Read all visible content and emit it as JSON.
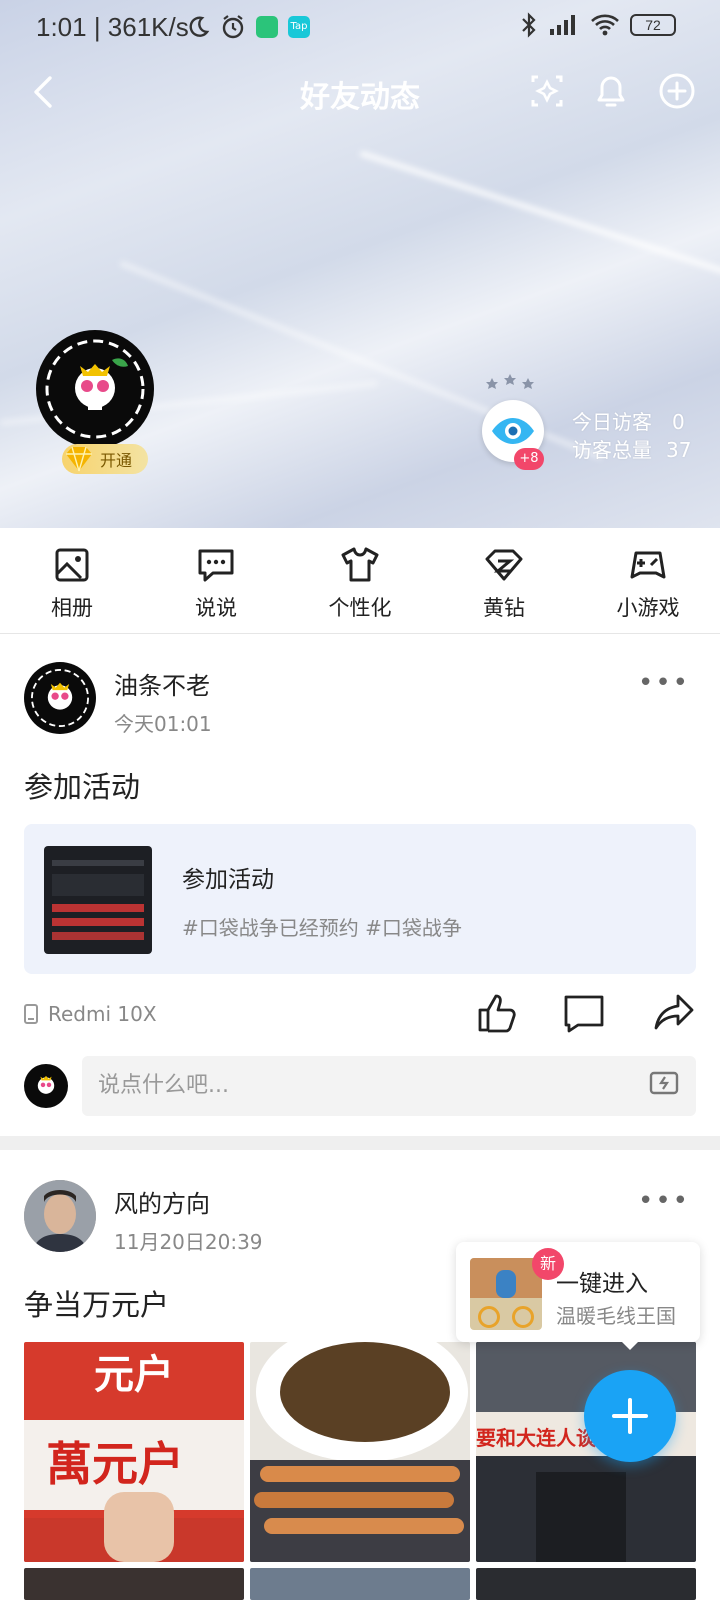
{
  "status_bar": {
    "time": "1:01 | 361K/s",
    "battery": "72",
    "app_badge": "Tap"
  },
  "nav": {
    "title": "好友动态"
  },
  "profile": {
    "vip_label": "开通",
    "visitor_plus": "+8",
    "today_visitors_label": "今日访客",
    "today_visitors_value": "0",
    "total_visitors_label": "访客总量",
    "total_visitors_value": "37"
  },
  "tabs": [
    {
      "label": "相册",
      "icon": "photo-album-icon"
    },
    {
      "label": "说说",
      "icon": "chat-bubble-icon"
    },
    {
      "label": "个性化",
      "icon": "tshirt-icon"
    },
    {
      "label": "黄钻",
      "icon": "diamond-icon"
    },
    {
      "label": "小游戏",
      "icon": "gamepad-icon"
    }
  ],
  "post1": {
    "author": "油条不老",
    "time": "今天01:01",
    "text": "参加活动",
    "share_title": "参加活动",
    "share_tags": "#口袋战争已经预约 #口袋战争",
    "device": "Redmi 10X",
    "comment_placeholder": "说点什么吧..."
  },
  "post2": {
    "author": "风的方向",
    "time": "11月20日20:39",
    "text": "争当万元户",
    "photo1_text_top": "元户",
    "photo1_text_main": "萬元户",
    "photo3_text": "要和大连人谈"
  },
  "promo": {
    "badge": "新",
    "title": "一键进入",
    "subtitle": "温暖毛线王国"
  },
  "colors": {
    "accent": "#1aa3f5",
    "badge_red": "#f2476a",
    "vip_gold": "#f7d36d"
  }
}
